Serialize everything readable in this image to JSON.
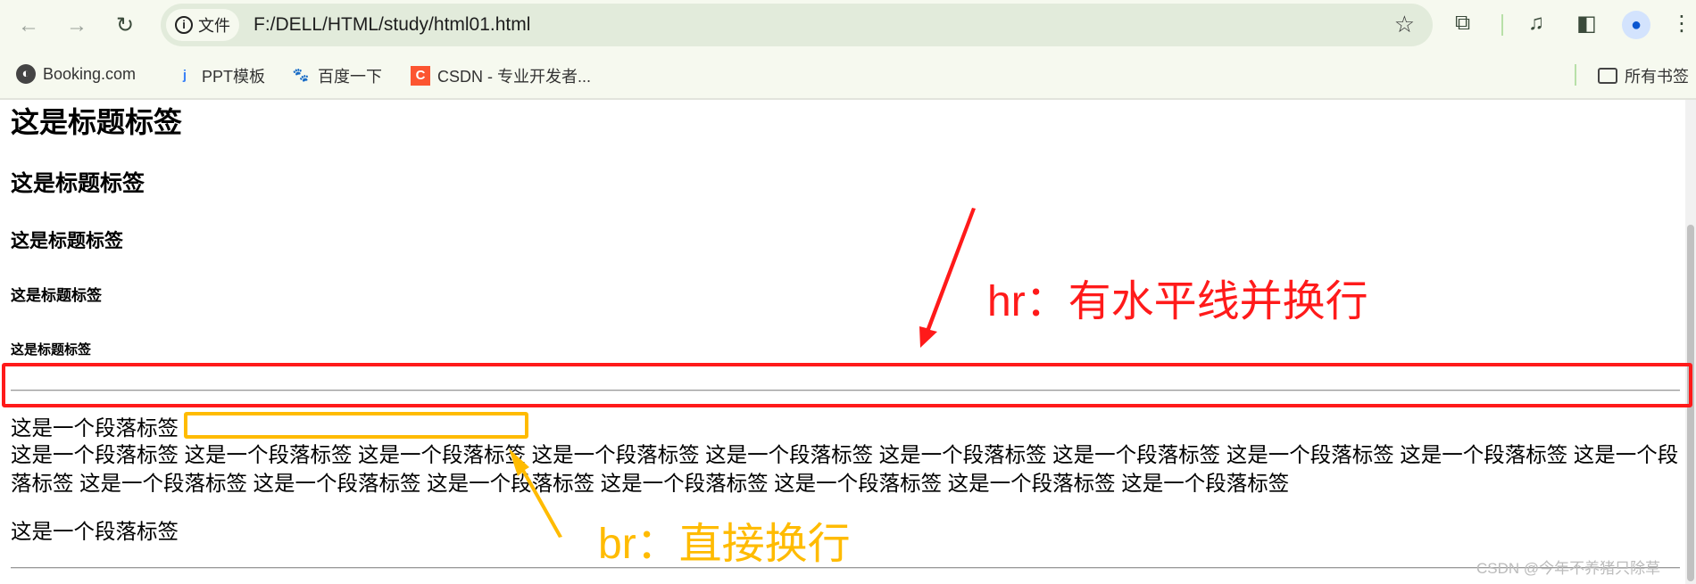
{
  "browser": {
    "tab_security_label": "文件",
    "url": "F:/DELL/HTML/study/html01.html",
    "icons": [
      "back-icon",
      "forward-icon",
      "reload-icon",
      "info-icon",
      "star-icon",
      "extensions-icon",
      "media-icon",
      "side-panel-icon",
      "profile-icon",
      "menu-icon"
    ]
  },
  "bookmarks": {
    "items": [
      {
        "label": "Booking.com",
        "icon": "globe-icon"
      },
      {
        "label": "PPT模板",
        "icon": "ppt-icon"
      },
      {
        "label": "百度一下",
        "icon": "baidu-icon"
      },
      {
        "label": "CSDN - 专业开发者...",
        "icon": "csdn-icon"
      }
    ],
    "all_bookmarks": "所有书签"
  },
  "content": {
    "h1": "这是标题标签",
    "h2": "这是标题标签",
    "h3": "这是标题标签",
    "h4": "这是标题标签",
    "h5": "这是标题标签",
    "p1": "这是一个段落标签",
    "p2": "这是一个段落标签 这是一个段落标签 这是一个段落标签 这是一个段落标签 这是一个段落标签 这是一个段落标签 这是一个段落标签 这是一个段落标签 这是一个段落标签 这是一个段落标签 这是一个段落标签 这是一个段落标签 这是一个段落标签 这是一个段落标签 这是一个段落标签 这是一个段落标签 这是一个段落标签",
    "p3": "这是一个段落标签"
  },
  "annotations": {
    "hr_note": "hr：有水平线并换行",
    "br_note": "br：直接换行",
    "hr_color": "#ff1a1a",
    "br_color": "#ffbb00"
  },
  "watermark": "CSDN @今年不养猪只除草"
}
